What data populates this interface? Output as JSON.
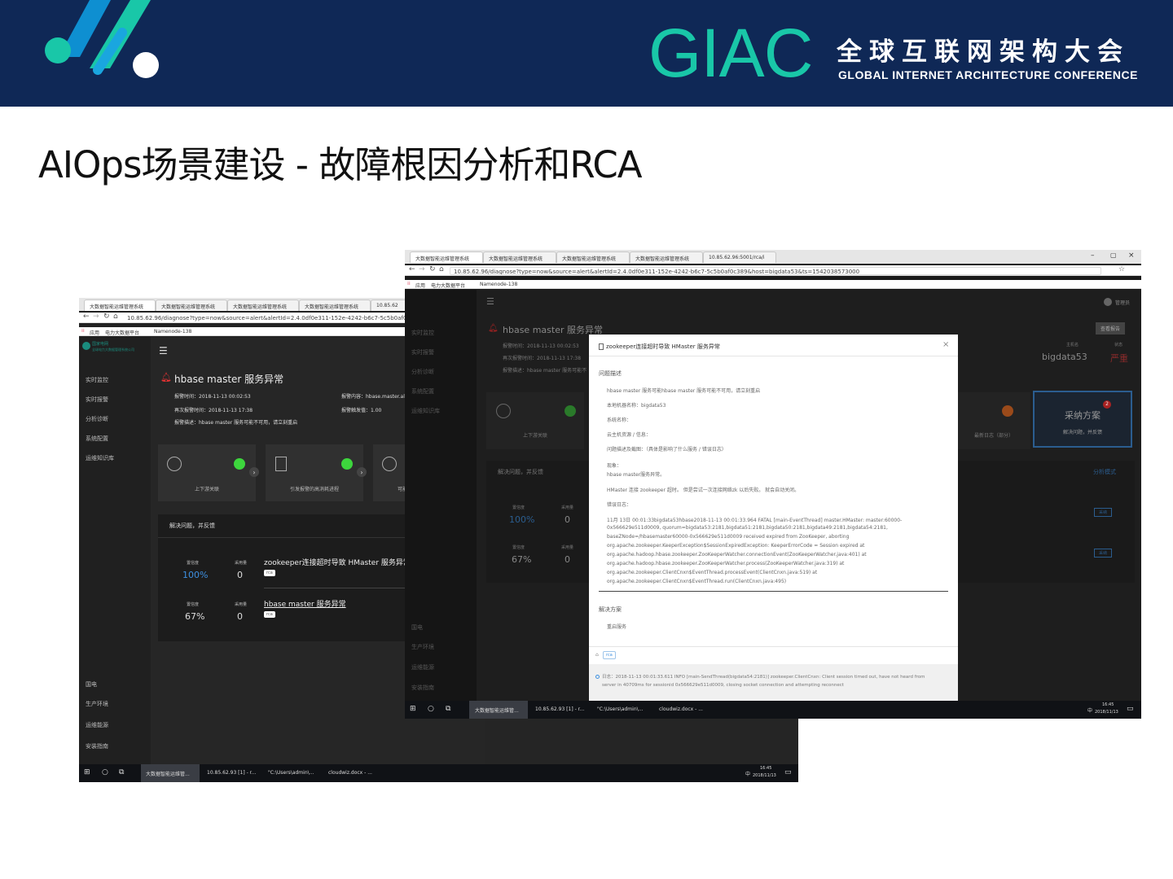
{
  "banner": {
    "brand": "GIAC",
    "conf_cn": "全球互联网架构大会",
    "conf_en": "GLOBAL INTERNET ARCHITECTURE CONFERENCE"
  },
  "slide_title": "AIOps场景建设 - 故障根因分析和RCA",
  "back": {
    "tabs": [
      "大数据智能运维管理系统",
      "大数据智能运维管理系统",
      "大数据智能运维管理系统",
      "大数据智能运维管理系统",
      "10.85.62"
    ],
    "url": "10.85.62.96/diagnose?type=now&source=alert&alertId=2.4.0df0e311-152e-4242-b6c7-5c5b0af0c389&hos",
    "bookmarks": [
      "应用",
      "电力大数据平台",
      "Namenode-138"
    ],
    "logo": [
      "国家电网",
      "全球电力大数据管理系统公司"
    ],
    "menu": [
      "实时监控",
      "实时报警",
      "分析诊断",
      "系统配置",
      "运维知识库"
    ],
    "menu2": [
      "国电",
      "生产环境",
      "运维能源",
      "安装指南"
    ],
    "header": "hbase master 服务异常",
    "alarm_time": "报警时间：2018-11-13 00:02:53",
    "alarm_content": "报警内容：hbase.master.ali",
    "again_time": "再次报警时间：2018-11-13 17:38",
    "alarm_count": "报警触发值：1.00",
    "alarm_desc": "报警描述：hbase master 服务可能不可用，请立刻重启",
    "cards": [
      "上下游关联",
      "引发报警的高消耗进程",
      "可能"
    ],
    "panel_title": "解决问题，并反馈",
    "rows": [
      {
        "l1": "置信度",
        "v1": "100%",
        "l2": "采用量",
        "v2": "0",
        "title": "zookeeper连接超时导致 HMaster 服务异常",
        "tag": "rca"
      },
      {
        "l1": "置信度",
        "v1": "67%",
        "l2": "采用量",
        "v2": "0",
        "title": "hbase master 服务异常",
        "tag": "rca"
      }
    ],
    "taskbar": [
      "大数据智能运维管...",
      "10.85.62.93 [1] - r...",
      "\"C:\\Users\\admin\\...",
      "cloudwiz.docx - ..."
    ],
    "clock": [
      "16:45",
      "2018/11/13"
    ],
    "ime": "中"
  },
  "front": {
    "tabs": [
      "大数据智能运维管理系统",
      "大数据智能运维管理系统",
      "大数据智能运维管理系统",
      "大数据智能运维管理系统",
      "10.85.62.96:5001/rca/i"
    ],
    "url": "10.85.62.96/diagnose?type=now&source=alert&alertId=2.4.0df0e311-152e-4242-b6c7-5c5b0af0c389&host=bigdata53&ts=1542038573000",
    "bookmarks": [
      "应用",
      "电力大数据平台",
      "Namenode-138"
    ],
    "user": "管理员",
    "header": "hbase master 服务异常",
    "report_btn": "查看报告",
    "host_label": "主机名",
    "host_value": "bigdata53",
    "status_label": "状态",
    "status_value": "严重",
    "alarm_time": "报警时间：2018-11-13 00:02:53",
    "again_time": "再次报警时间：2018-11-13 17:38",
    "alarm_desc": "报警描述：hbase master 服务可能不",
    "card_left": "上下游关联",
    "card_right": "最新日志（部分）",
    "adopt_title": "采纳方案",
    "adopt_sub": "解决问题，并反馈",
    "adopt_badge": "2",
    "panel_title": "解决问题，并反馈",
    "panel_hint": "分析模式",
    "rows": [
      {
        "l1": "置信度",
        "v1": "100%",
        "l2": "采用量",
        "v2": "0",
        "btn": "采纳"
      },
      {
        "l1": "置信度",
        "v1": "67%",
        "l2": "采用量",
        "v2": "0",
        "btn": "采纳"
      }
    ],
    "taskbar": [
      "大数据智能运维管...",
      "10.85.62.93 [1] - r...",
      "\"C:\\Users\\admin\\...",
      "cloudwiz.docx - ..."
    ],
    "clock": [
      "16:45",
      "2018/11/13"
    ],
    "ime": "中"
  },
  "modal": {
    "title": "zookeeper连接超时导致 HMaster 服务异常",
    "sec1": "问题描述",
    "lines": [
      "hbase master 服务可能hbase master 服务可能不可用，请立刻重启",
      "本地机器名称：bigdata53",
      "系统名称：",
      "云主机资源 / 信息：",
      "问题描述及截图：（具体是影响了什么服务 / 错误日志）",
      "现象：",
      "hbase master服务异常。",
      "HMaster 连接 zookeeper 超时。 但是尝试一次连接网络zk 以后失败。 就会自动关闭。",
      "错误日志：",
      "11月 13日 00:01:33bigdata53hbase2018-11-13 00:01:33.964 FATAL [main-EventThread] master.HMaster: master:60000-",
      "0x566629e511d0009, quorum=bigdata53:2181,bigdata51:2181,bigdata50:2181,bigdata49:2181,bigdata54:2181,",
      "baseZNode=/hbasemaster60000-0x566629e511d0009 received expired from ZooKeeper, aborting",
      "org.apache.zookeeper.KeeperException$SessionExpiredException: KeeperErrorCode = Session expired at",
      "org.apache.hadoop.hbase.zookeeper.ZooKeeperWatcher.connectionEvent(ZooKeeperWatcher.java:401) at",
      "org.apache.hadoop.hbase.zookeeper.ZooKeeperWatcher.process(ZooKeeperWatcher.java:319) at",
      "org.apache.zookeeper.ClientCnxn$EventThread.processEvent(ClientCnxn.java:519) at",
      "org.apache.zookeeper.ClientCnxn$EventThread.run(ClientCnxn.java:495)"
    ],
    "sec2": "解决方案",
    "solution": "重启服务",
    "tag": "rca",
    "log1": "日志：2018-11-13 00:01:33.611 INFO [main-SendThread(bigdata54:2181)] zookeeper.ClientCnxn: Client session timed out, have not heard from",
    "log2": "server in 40709ms for sessionid 0x566629e511d0009, closing socket connection and attempting reconnect"
  }
}
